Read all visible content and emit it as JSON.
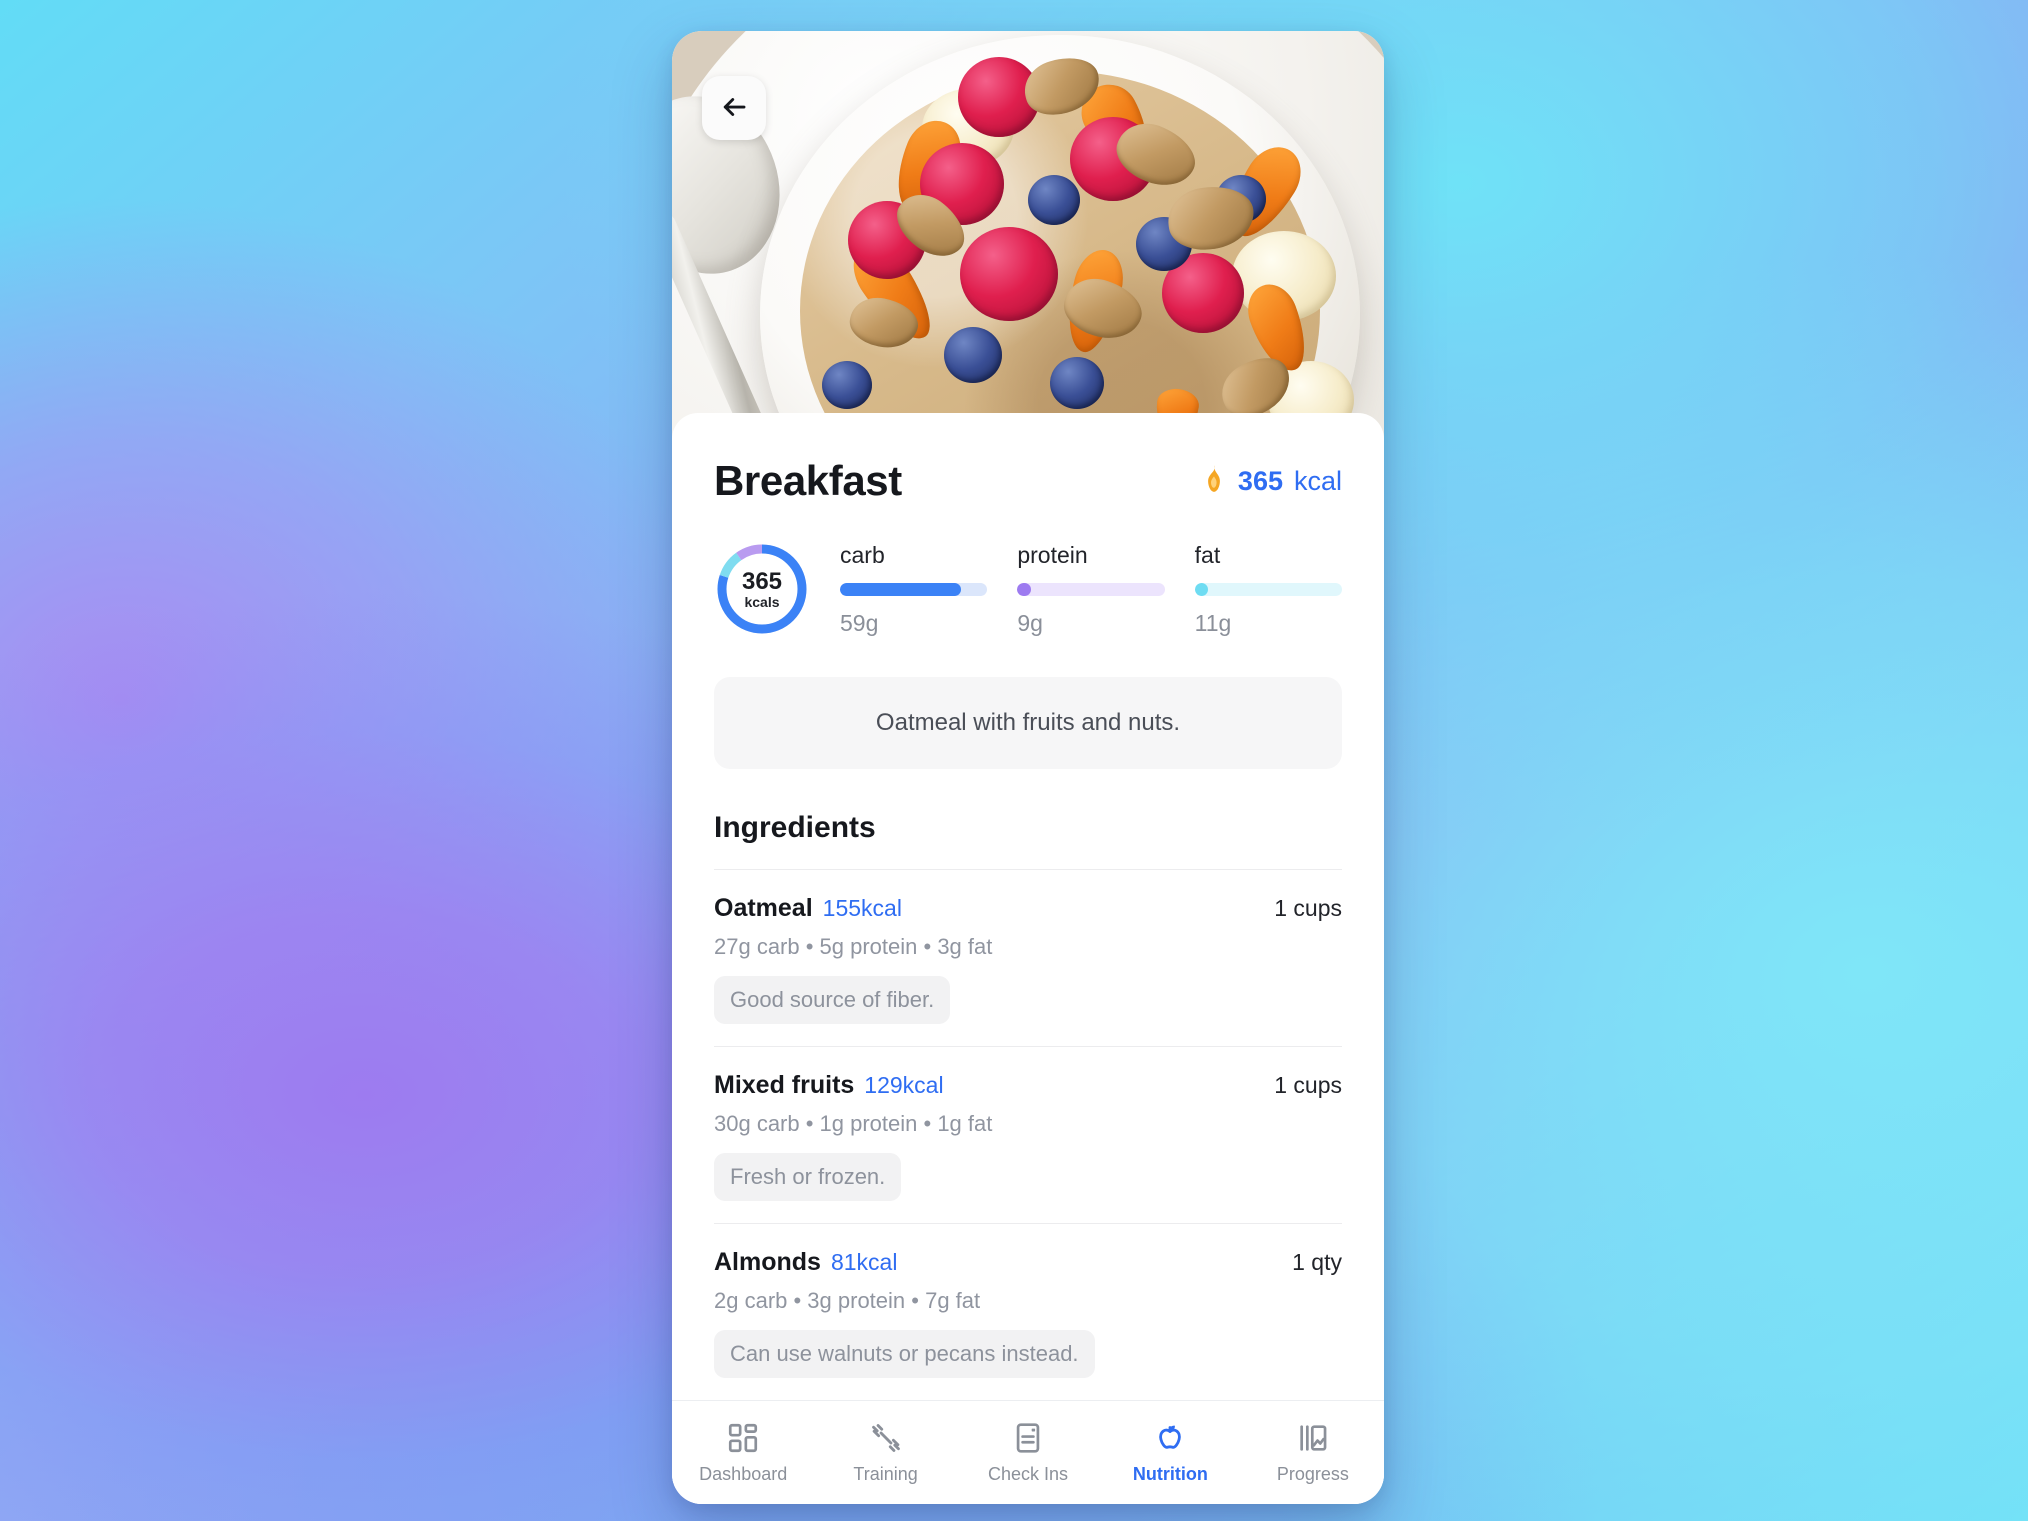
{
  "screen": {
    "back_icon": "arrow-left-icon",
    "title": "Breakfast",
    "header_kcal_icon": "flame-icon",
    "header_kcal_value": "365",
    "header_kcal_unit": "kcal",
    "accent_color": "#2f6df2"
  },
  "ring": {
    "value": "365",
    "unit": "kcals",
    "segments": [
      {
        "name": "carb",
        "percent": 80,
        "color": "#3b82f6"
      },
      {
        "name": "fat",
        "percent": 10,
        "color": "#7fdcf0"
      },
      {
        "name": "protein",
        "percent": 10,
        "color": "#b99bf0"
      }
    ]
  },
  "macros": [
    {
      "name": "carb",
      "grams": "59g",
      "percent": 82,
      "fill_color": "#3b82f6",
      "track_color": "#dbe6fb"
    },
    {
      "name": "protein",
      "grams": "9g",
      "percent": 9,
      "fill_color": "#9d7bf0",
      "track_color": "#ece4fd"
    },
    {
      "name": "fat",
      "grams": "11g",
      "percent": 9,
      "fill_color": "#6edcf2",
      "track_color": "#e0f7fc"
    }
  ],
  "description": "Oatmeal with fruits and nuts.",
  "ingredients_heading": "Ingredients",
  "ingredients": [
    {
      "name": "Oatmeal",
      "kcal": "155kcal",
      "qty": "1 cups",
      "macros": "27g carb • 5g protein • 3g fat",
      "note": "Good source of fiber."
    },
    {
      "name": "Mixed fruits",
      "kcal": "129kcal",
      "qty": "1 cups",
      "macros": "30g carb • 1g protein • 1g fat",
      "note": "Fresh or frozen."
    },
    {
      "name": "Almonds",
      "kcal": "81kcal",
      "qty": "1 qty",
      "macros": "2g carb • 3g protein • 7g fat",
      "note": "Can use walnuts or pecans instead."
    }
  ],
  "tabs": [
    {
      "label": "Dashboard",
      "icon": "grid-icon",
      "active": false
    },
    {
      "label": "Training",
      "icon": "dumbbell-icon",
      "active": false
    },
    {
      "label": "Check Ins",
      "icon": "clipboard-icon",
      "active": false
    },
    {
      "label": "Nutrition",
      "icon": "apple-icon",
      "active": true
    },
    {
      "label": "Progress",
      "icon": "chart-icon",
      "active": false
    }
  ]
}
